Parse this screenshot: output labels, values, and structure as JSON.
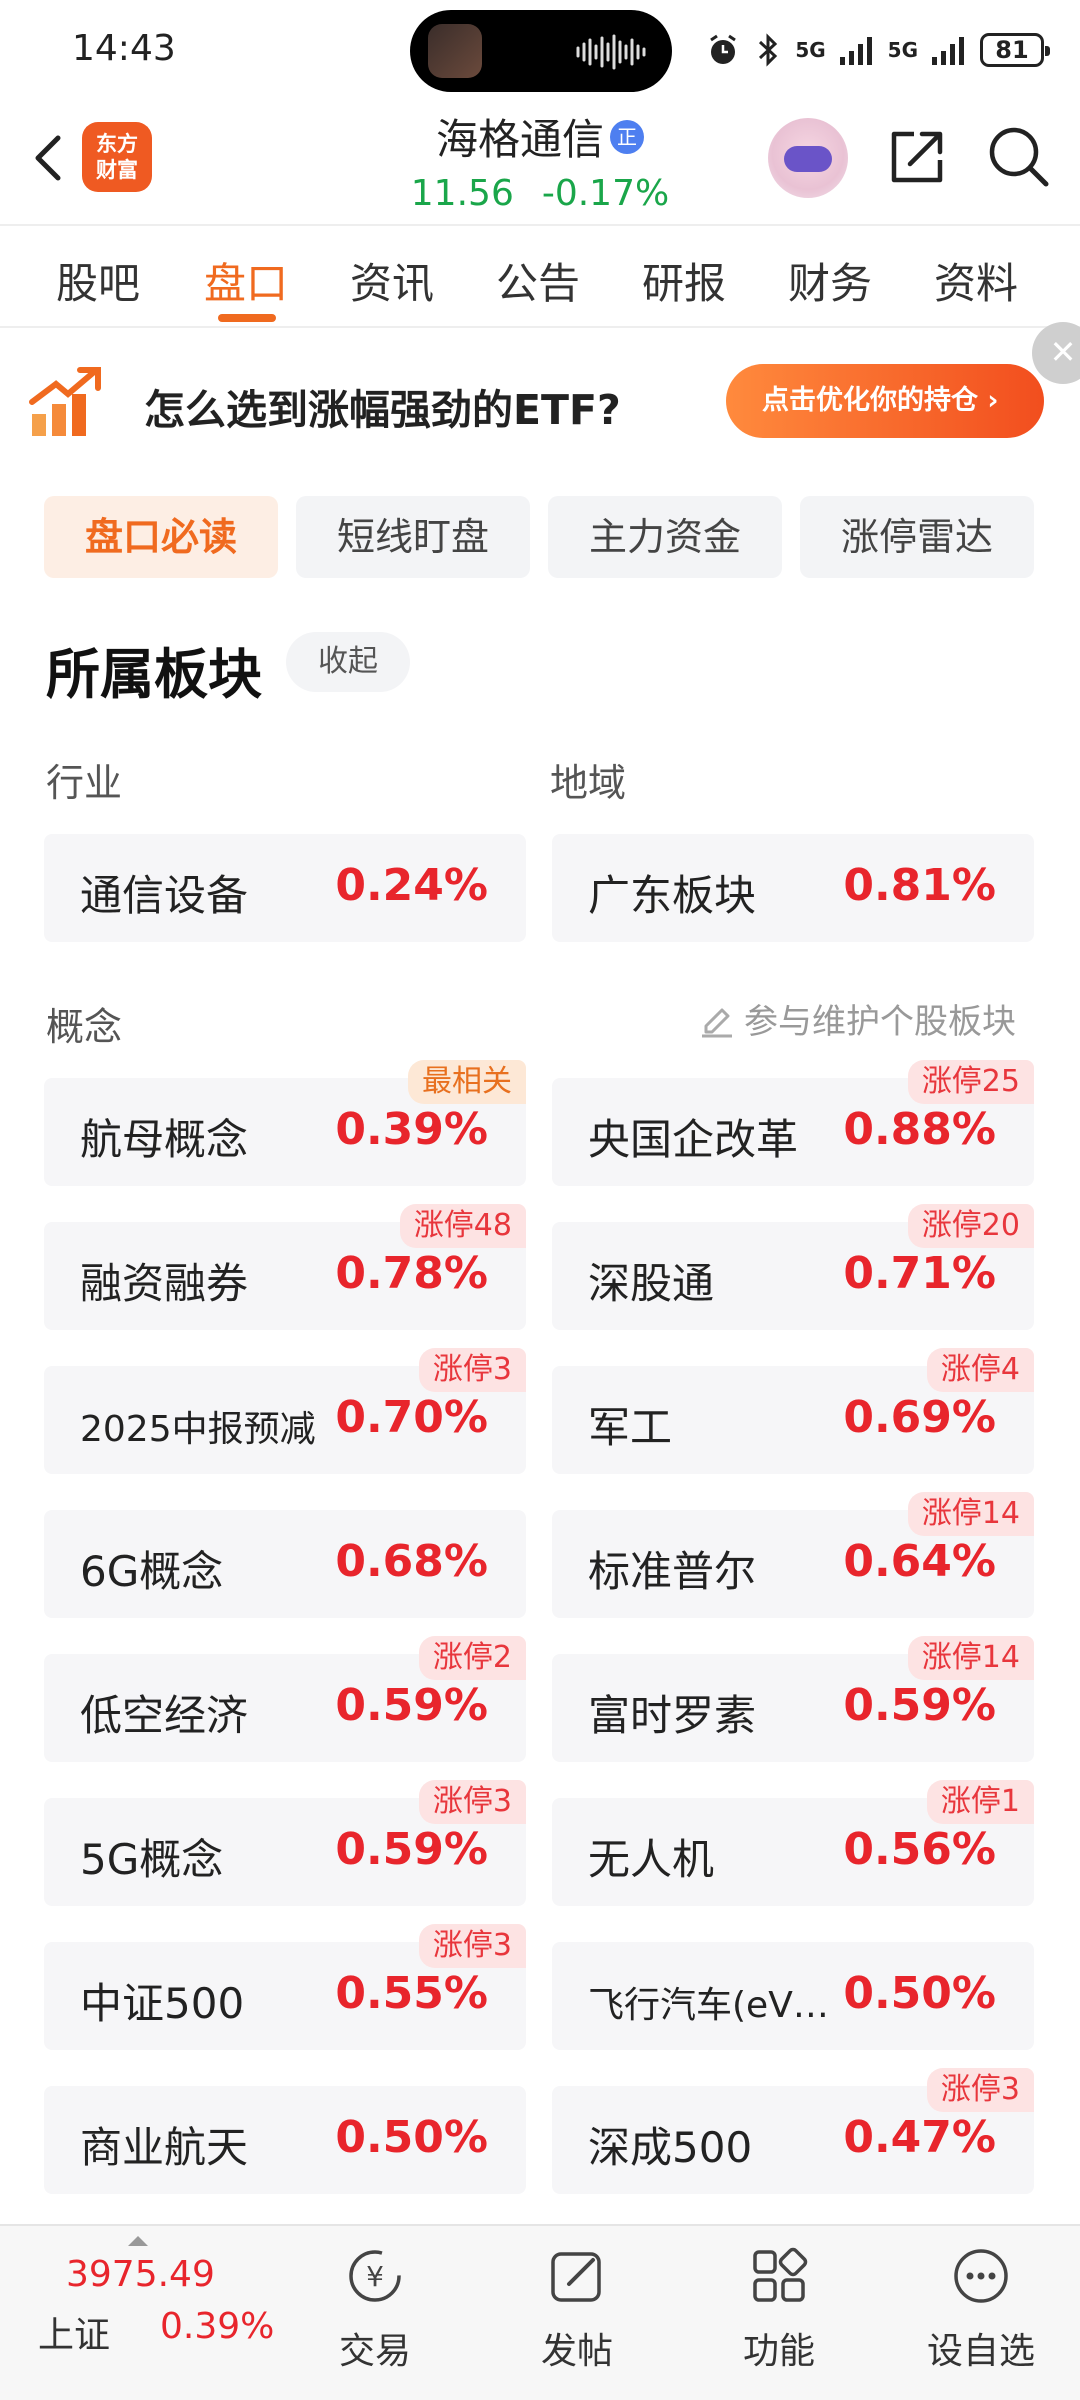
{
  "status_bar": {
    "time": "14:43",
    "battery": "81",
    "signal_1": "5G",
    "signal_2": "5G"
  },
  "header": {
    "logo_text_line1": "东方",
    "logo_text_line2": "财富",
    "stock_name": "海格通信",
    "badge": "正",
    "price": "11.56",
    "change": "-0.17%"
  },
  "tabs": [
    "股吧",
    "盘口",
    "资讯",
    "公告",
    "研报",
    "财务",
    "资料"
  ],
  "active_tab": 1,
  "banner": {
    "text": "怎么选到涨幅强劲的ETF?",
    "button": "点击优化你的持仓 ›",
    "close": "✕"
  },
  "subtabs": [
    "盘口必读",
    "短线盯盘",
    "主力资金",
    "涨停雷达"
  ],
  "section": {
    "title": "所属板块",
    "collapse": "收起",
    "industry_label": "行业",
    "region_label": "地域",
    "concept_label": "概念",
    "maintain_text": "参与维护个股板块"
  },
  "industry": {
    "name": "通信设备",
    "pct": "0.24%"
  },
  "region": {
    "name": "广东板块",
    "pct": "0.81%"
  },
  "concepts": [
    {
      "name": "航母概念",
      "pct": "0.39%",
      "badge": "最相关"
    },
    {
      "name": "央国企改革",
      "pct": "0.88%",
      "badge": "涨停25"
    },
    {
      "name": "融资融券",
      "pct": "0.78%",
      "badge": "涨停48"
    },
    {
      "name": "深股通",
      "pct": "0.71%",
      "badge": "涨停20"
    },
    {
      "name": "2025中报预减",
      "pct": "0.70%",
      "badge": "涨停3"
    },
    {
      "name": "军工",
      "pct": "0.69%",
      "badge": "涨停4"
    },
    {
      "name": "6G概念",
      "pct": "0.68%",
      "badge": ""
    },
    {
      "name": "标准普尔",
      "pct": "0.64%",
      "badge": "涨停14"
    },
    {
      "name": "低空经济",
      "pct": "0.59%",
      "badge": "涨停2"
    },
    {
      "name": "富时罗素",
      "pct": "0.59%",
      "badge": "涨停14"
    },
    {
      "name": "5G概念",
      "pct": "0.59%",
      "badge": "涨停3"
    },
    {
      "name": "无人机",
      "pct": "0.56%",
      "badge": "涨停1"
    },
    {
      "name": "中证500",
      "pct": "0.55%",
      "badge": "涨停3"
    },
    {
      "name": "飞行汽车(eVT…",
      "pct": "0.50%",
      "badge": ""
    },
    {
      "name": "商业航天",
      "pct": "0.50%",
      "badge": ""
    },
    {
      "name": "深成500",
      "pct": "0.47%",
      "badge": "涨停3"
    }
  ],
  "bottom_nav": {
    "index_value": "3975.49",
    "index_name": "上证",
    "index_pct": "0.39%",
    "items": [
      "交易",
      "发帖",
      "功能",
      "设自选"
    ]
  },
  "colors": {
    "accent": "#f06a1f",
    "rise": "#e8252c",
    "fall": "#1aa64a"
  }
}
